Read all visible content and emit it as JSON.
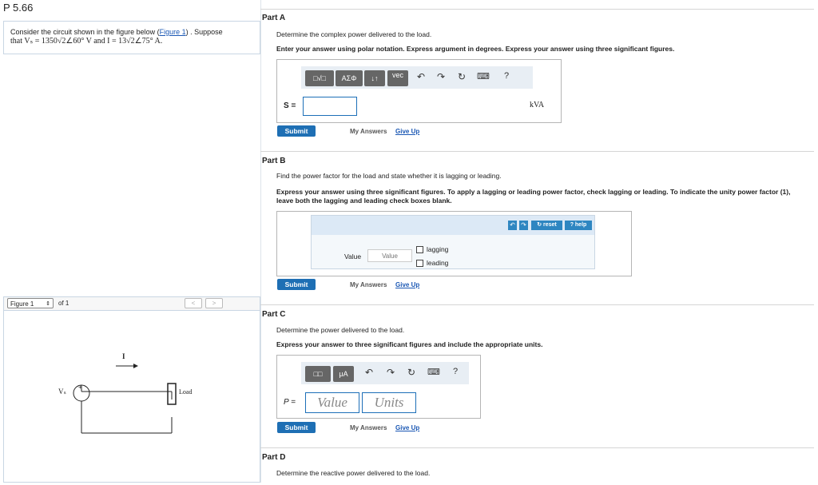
{
  "problem": {
    "title": "P 5.66",
    "question_pre": "Consider the circuit shown in the figure below (",
    "figure_link": "Figure 1",
    "question_post": ") . Suppose",
    "line2": "that Vₛ = 1350√2∠60° V and I = 13√2∠75° A."
  },
  "figure_nav": {
    "select": "Figure 1",
    "of": "of 1",
    "prev": "<",
    "next": ">"
  },
  "figure": {
    "current_label": "I",
    "source_label": "Vₛ",
    "source_sign": "+",
    "load_label": "Load"
  },
  "partA": {
    "title": "Part A",
    "prompt": "Determine the complex power delivered to the load.",
    "instruction": "Enter your answer using polar notation. Express argument in degrees. Express your answer using three significant figures.",
    "tools": [
      "□√□",
      "AΣΦ",
      "↓↑",
      "vec"
    ],
    "icons": [
      "↶",
      "↷",
      "↻",
      "⌨",
      "?"
    ],
    "var_label": "S =",
    "unit": "kVA",
    "submit": "Submit",
    "my_answers": "My Answers",
    "give_up": "Give Up"
  },
  "partB": {
    "title": "Part B",
    "prompt": "Find the power factor for the load and state whether it is lagging or leading.",
    "instruction": "Express your answer using three significant figures. To apply a lagging or leading power factor, check lagging or leading. To indicate the unity power factor (1), leave both the lagging and leading check boxes blank.",
    "tool_undo": "↶",
    "tool_redo": "↷",
    "tool_reset": "↻ reset",
    "tool_help": "? help",
    "value_label": "Value",
    "value_placeholder": "Value",
    "lagging": "lagging",
    "leading": "leading",
    "submit": "Submit",
    "my_answers": "My Answers",
    "give_up": "Give Up"
  },
  "partC": {
    "title": "Part C",
    "prompt": "Determine the power delivered to the load.",
    "instruction": "Express your answer to three significant figures and include the appropriate units.",
    "tools": [
      "□□",
      "μA"
    ],
    "icons": [
      "↶",
      "↷",
      "↻",
      "⌨",
      "?"
    ],
    "var_label": "P =",
    "value_placeholder": "Value",
    "units_placeholder": "Units",
    "submit": "Submit",
    "my_answers": "My Answers",
    "give_up": "Give Up"
  },
  "partD": {
    "title": "Part D",
    "prompt": "Determine the reactive power delivered to the load."
  }
}
